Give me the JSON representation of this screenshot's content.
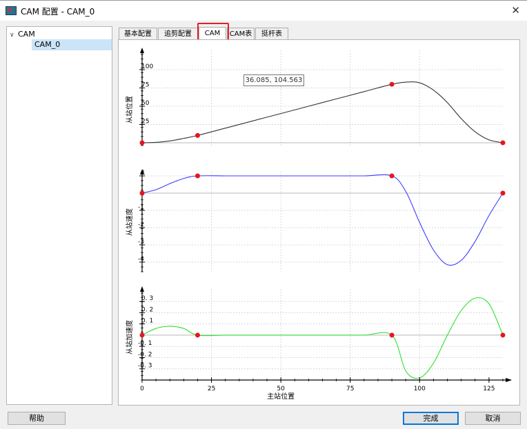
{
  "window": {
    "title": "CAM 配置 - CAM_0",
    "close": "✕"
  },
  "tree": {
    "root": "CAM",
    "child": "CAM_0"
  },
  "tabs": [
    "基本配置",
    "追剪配置",
    "CAM",
    "CAM表",
    "挺杆表"
  ],
  "active_tab": "CAM",
  "tooltip": "36.085, 104.563",
  "buttons": {
    "help": "帮助",
    "finish": "完成",
    "cancel": "取消"
  },
  "colors": {
    "position": "#333333",
    "velocity": "#3a3aff",
    "acceleration": "#2fe02f",
    "keypoint": "#e8141e"
  },
  "chart_data": [
    {
      "type": "line",
      "ylabel": "从站位置",
      "xlabel": "",
      "xlim": [
        0,
        130
      ],
      "ylim": [
        0,
        100
      ],
      "yticks": [
        25,
        50,
        75,
        100
      ],
      "keypoints": [
        [
          0,
          0
        ],
        [
          20,
          10
        ],
        [
          90,
          80
        ],
        [
          130,
          0
        ]
      ],
      "x": [
        0,
        5,
        10,
        15,
        20,
        30,
        40,
        50,
        60,
        70,
        80,
        90,
        95,
        100,
        105,
        110,
        115,
        120,
        125,
        130
      ],
      "values": [
        0,
        0.5,
        2.5,
        6,
        10,
        20,
        30,
        40,
        50,
        60,
        70,
        80,
        83,
        82,
        72,
        55,
        33,
        15,
        4,
        0
      ]
    },
    {
      "type": "line",
      "ylabel": "从站速度",
      "xlabel": "",
      "xlim": [
        0,
        130
      ],
      "ylim": [
        -4.4,
        1.2
      ],
      "yticks": [
        1,
        -1,
        -2,
        -3,
        -4
      ],
      "keypoints": [
        [
          0,
          0
        ],
        [
          20,
          1
        ],
        [
          90,
          1
        ],
        [
          130,
          0
        ]
      ],
      "x": [
        0,
        5,
        10,
        15,
        20,
        30,
        40,
        50,
        60,
        70,
        80,
        90,
        95,
        100,
        105,
        110,
        115,
        120,
        125,
        130
      ],
      "values": [
        0,
        0.2,
        0.55,
        0.85,
        1,
        1,
        1,
        1,
        1,
        1,
        1,
        1,
        0.1,
        -1.7,
        -3.3,
        -4.15,
        -3.9,
        -2.8,
        -1.3,
        0
      ]
    },
    {
      "type": "line",
      "ylabel": "从站加速度",
      "xlabel": "主站位置",
      "xlim": [
        0,
        130
      ],
      "ylim": [
        -0.4,
        0.35
      ],
      "yticks": [
        0.3,
        0.2,
        0.1,
        -0.1,
        -0.2,
        -0.3
      ],
      "yticklabels": [
        "0. 3",
        "0. 2",
        "0. 1",
        "-0. 1",
        "-0. 2",
        "-0. 3"
      ],
      "xticks": [
        0,
        25,
        50,
        75,
        100,
        125
      ],
      "keypoints": [
        [
          0,
          0
        ],
        [
          20,
          0
        ],
        [
          90,
          0
        ],
        [
          130,
          0
        ]
      ],
      "x": [
        0,
        5,
        10,
        15,
        20,
        30,
        40,
        50,
        60,
        70,
        80,
        90,
        95,
        100,
        105,
        110,
        115,
        120,
        125,
        130
      ],
      "values": [
        0,
        0.06,
        0.08,
        0.06,
        0,
        0,
        0,
        0,
        0,
        0,
        0,
        0,
        -0.32,
        -0.38,
        -0.25,
        0,
        0.22,
        0.33,
        0.28,
        0
      ]
    }
  ]
}
